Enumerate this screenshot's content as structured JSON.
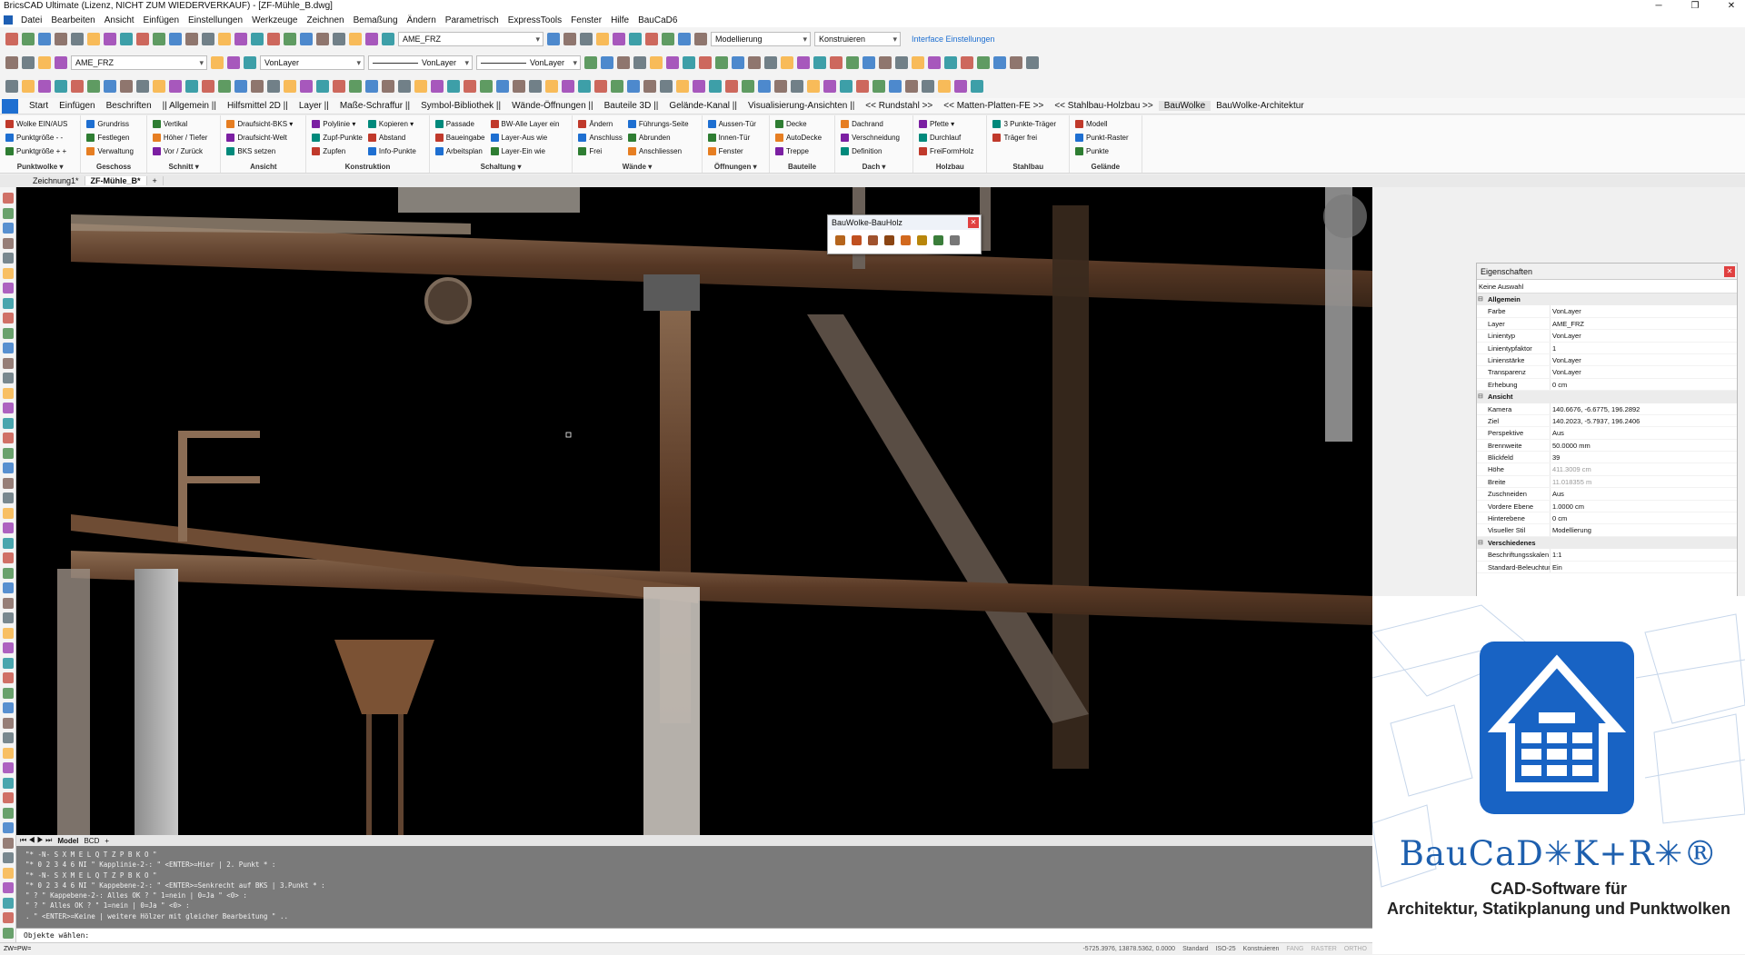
{
  "window": {
    "title": "BricsCAD Ultimate (Lizenz, NICHT ZUM WIEDERVERKAUF) - [ZF-Mühle_B.dwg]"
  },
  "menu": [
    "Datei",
    "Bearbeiten",
    "Ansicht",
    "Einfügen",
    "Einstellungen",
    "Werkzeuge",
    "Zeichnen",
    "Bemaßung",
    "Ändern",
    "Parametrisch",
    "ExpressTools",
    "Fenster",
    "Hilfe",
    "BauCaD6"
  ],
  "toolbar1": {
    "layer_combo": "AME_FRZ",
    "workspace_combo": "Modellierung",
    "mode_combo": "Konstruieren",
    "interface_link": "Interface Einstellungen"
  },
  "toolbar2": {
    "layer_combo": "AME_FRZ",
    "color_combo": "VonLayer",
    "linetype_combo": "VonLayer",
    "lineweight_combo": "VonLayer"
  },
  "ribbon_tabs": [
    "Start",
    "Einfügen",
    "Beschriften",
    "|| Allgemein ||",
    "Hilfsmittel 2D ||",
    "Layer ||",
    "Maße-Schraffur ||",
    "Symbol-Bibliothek ||",
    "Wände-Öffnungen ||",
    "Bauteile 3D ||",
    "Gelände-Kanal ||",
    "Visualisierung-Ansichten ||",
    "<< Rundstahl >>",
    "<< Matten-Platten-FE >>",
    "<< Stahlbau-Holzbau >>",
    "BauWolke",
    "BauWolke-Architektur"
  ],
  "ribbon_active_tab": "BauWolke",
  "ribbon_groups": [
    {
      "label": "Punktwolke ▾",
      "cols": [
        [
          "Wolke EIN/AUS",
          "Punktgröße - -",
          "Punktgröße + +"
        ]
      ]
    },
    {
      "label": "Geschoss",
      "cols": [
        [
          "Grundriss",
          "Festlegen",
          "Verwaltung"
        ]
      ]
    },
    {
      "label": "Schnitt ▾",
      "cols": [
        [
          "Vertikal",
          "Höher / Tiefer",
          "Vor / Zurück"
        ]
      ]
    },
    {
      "label": "Ansicht",
      "cols": [
        [
          "Draufsicht-BKS ▾",
          "Draufsicht-Welt",
          "BKS setzen"
        ]
      ]
    },
    {
      "label": "Konstruktion",
      "cols": [
        [
          "Polylinie ▾",
          "Zupf-Punkte",
          "Zupfen"
        ],
        [
          "Kopieren ▾",
          "Abstand",
          "Info-Punkte"
        ]
      ]
    },
    {
      "label": "Schaltung ▾",
      "cols": [
        [
          "Passade",
          "Baueingabe",
          "Arbeitsplan"
        ],
        [
          "BW-Alle Layer ein",
          "Layer-Aus wie",
          "Layer-Ein wie"
        ]
      ]
    },
    {
      "label": "Wände ▾",
      "cols": [
        [
          "Ändern",
          "Anschluss",
          "Frei"
        ],
        [
          "Führungs-Seite",
          "Abrunden",
          "Anschliessen"
        ]
      ]
    },
    {
      "label": "Öffnungen ▾",
      "cols": [
        [
          "Aussen-Tür",
          "Innen-Tür",
          "Fenster"
        ]
      ]
    },
    {
      "label": "Bauteile",
      "cols": [
        [
          "Decke",
          "AutoDecke",
          "Treppe"
        ]
      ]
    },
    {
      "label": "Dach ▾",
      "cols": [
        [
          "Dachrand",
          "Verschneidung",
          "Definition"
        ]
      ]
    },
    {
      "label": "Holzbau",
      "cols": [
        [
          "Pfette ▾",
          "Durchlauf",
          "FreiFormHolz"
        ]
      ]
    },
    {
      "label": "Stahlbau",
      "cols": [
        [
          "3 Punkte-Träger",
          "Träger frei"
        ]
      ]
    },
    {
      "label": "Gelände",
      "cols": [
        [
          "Modell",
          "Punkt-Raster",
          "Punkte"
        ]
      ]
    }
  ],
  "doc_tabs": [
    "Zeichnung1*",
    "ZF-Mühle_B*",
    "+"
  ],
  "palette": {
    "title": "BauWolke-BauHolz"
  },
  "properties": {
    "title": "Eigenschaften",
    "selection": "Keine Auswahl",
    "sections": [
      {
        "name": "Allgemein",
        "rows": [
          {
            "k": "Farbe",
            "v": "VonLayer"
          },
          {
            "k": "Layer",
            "v": "AME_FRZ"
          },
          {
            "k": "Linientyp",
            "v": "VonLayer"
          },
          {
            "k": "Linientypfaktor",
            "v": "1"
          },
          {
            "k": "Linienstärke",
            "v": "VonLayer"
          },
          {
            "k": "Transparenz",
            "v": "VonLayer"
          },
          {
            "k": "Erhebung",
            "v": "0 cm"
          }
        ]
      },
      {
        "name": "Ansicht",
        "rows": [
          {
            "k": "Kamera",
            "v": "140.6676, -6.6775, 196.2892"
          },
          {
            "k": "Ziel",
            "v": "140.2023, -5.7937, 196.2406"
          },
          {
            "k": "Perspektive",
            "v": "Aus"
          },
          {
            "k": "Brennweite",
            "v": "50.0000 mm"
          },
          {
            "k": "Blickfeld",
            "v": "39"
          },
          {
            "k": "Höhe",
            "v": "411.3009 cm",
            "dim": true
          },
          {
            "k": "Breite",
            "v": "11.018355 m",
            "dim": true
          },
          {
            "k": "Zuschneiden",
            "v": "Aus"
          },
          {
            "k": "Vordere Ebene",
            "v": "1.0000 cm"
          },
          {
            "k": "Hinterebene",
            "v": "0 cm"
          },
          {
            "k": "Visueller Stil",
            "v": "Modellierung"
          }
        ]
      },
      {
        "name": "Verschiedenes",
        "rows": [
          {
            "k": "Beschriftungsskalen",
            "v": "1:1"
          },
          {
            "k": "Standard-Beleuchtun",
            "v": "Ein"
          }
        ]
      }
    ]
  },
  "layout_tabs": [
    "Model",
    "BCD",
    "+"
  ],
  "command_lines": [
    "\"* -N- S X M E L Q T Z P B K O \"",
    "\"* 0 2 3 4 6 NI \" Kapplinie-2-: \" <ENTER>=Hier | 2. Punkt * :",
    "\"* -N- S X M E L Q T Z P B K O \"",
    "\"* 0 2 3 4 6 NI \" Kappebene-2-: \" <ENTER>=Senkrecht auf BKS | 3.Punkt * :",
    "\" ? \" Kappebene-2-: Alles OK ? \" 1=nein | 0=Ja \" <0> :",
    "\" ? \" Alles OK ? \" 1=nein | 0=Ja \" <0> :",
    ". \" <ENTER>=Keine | weitere Hölzer mit gleicher Bearbeitung \" .."
  ],
  "command_prompt": "Objekte wählen:",
  "status": {
    "left": "ZW=PW=",
    "coords": "-5725.3976, 13878.5362, 0.0000",
    "items": [
      "Standard",
      "ISO-25",
      "Konstruieren",
      "FANG",
      "RASTER",
      "ORTHO"
    ]
  },
  "ad": {
    "brand": "BauCaD✳K+R✳®",
    "tagline1": "CAD-Software für",
    "tagline2": "Architektur, Statikplanung und Punktwolken"
  },
  "colors": {
    "accent": "#1e6fd1",
    "brand_blue": "#1863c4",
    "viewport_bg": "#000000",
    "command_bg": "#7a7a7a"
  }
}
